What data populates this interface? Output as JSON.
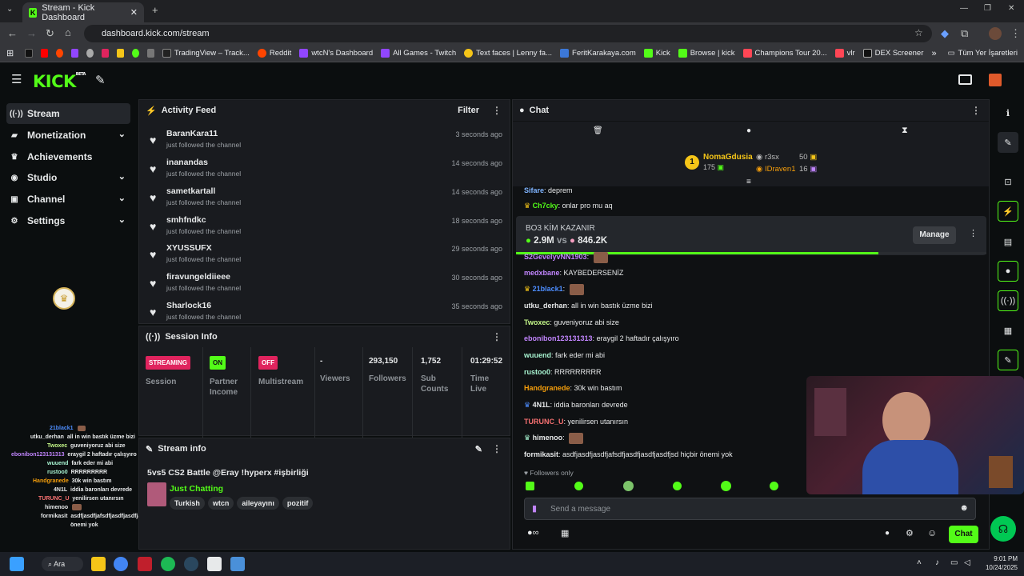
{
  "browser": {
    "tab_title": "Stream - Kick Dashboard",
    "url": "dashboard.kick.com/stream",
    "bookmarks": [
      "TradingView – Track...",
      "Reddit",
      "wtcN's Dashboard",
      "All Games - Twitch",
      "Text faces | Lenny fa...",
      "FeritKarakaya.com",
      "Kick",
      "Browse | kick",
      "Champions Tour 20...",
      "vlr",
      "DEX Screener"
    ],
    "bookmarks_folder": "Tüm Yer İşaretleri"
  },
  "app": {
    "logo": "KICK",
    "beta": "BETA"
  },
  "sidebar": {
    "items": [
      {
        "label": "Stream",
        "icon": "broadcast-icon"
      },
      {
        "label": "Monetization",
        "icon": "dollar-icon"
      },
      {
        "label": "Achievements",
        "icon": "trophy-icon"
      },
      {
        "label": "Studio",
        "icon": "camera-icon"
      },
      {
        "label": "Channel",
        "icon": "tv-icon"
      },
      {
        "label": "Settings",
        "icon": "gear-icon"
      }
    ]
  },
  "activity_feed": {
    "title": "Activity Feed",
    "filter": "Filter",
    "items": [
      {
        "name": "BaranKara11",
        "action": "just followed the channel",
        "time": "3 seconds ago"
      },
      {
        "name": "inanandas",
        "action": "just followed the channel",
        "time": "14 seconds ago"
      },
      {
        "name": "sametkartall",
        "action": "just followed the channel",
        "time": "14 seconds ago"
      },
      {
        "name": "smhfndkc",
        "action": "just followed the channel",
        "time": "18 seconds ago"
      },
      {
        "name": "XYUSSUFX",
        "action": "just followed the channel",
        "time": "29 seconds ago"
      },
      {
        "name": "firavungeldiieee",
        "action": "just followed the channel",
        "time": "30 seconds ago"
      },
      {
        "name": "Sharlock16",
        "action": "just followed the channel",
        "time": "35 seconds ago"
      }
    ]
  },
  "session_info": {
    "title": "Session Info",
    "session_badge": "STREAMING",
    "session_label": "Session",
    "partner_badge": "ON",
    "partner_label_1": "Partner",
    "partner_label_2": "Income",
    "multistream_badge": "OFF",
    "multistream_label": "Multistream",
    "viewers_value": "-",
    "viewers_label": "Viewers",
    "followers_value": "293,150",
    "followers_label": "Followers",
    "subs_value": "1,752",
    "subs_label_1": "Sub",
    "subs_label_2": "Counts",
    "time_value": "01:29:52",
    "time_label_1": "Time",
    "time_label_2": "Live"
  },
  "stream_info": {
    "title": "Stream info",
    "stream_title": "5vs5 CS2 Battle @Eray !hyperx #işbirliği",
    "category": "Just Chatting",
    "tags": [
      "Turkish",
      "wtcn",
      "aileyayını",
      "pozitif"
    ]
  },
  "chat": {
    "title": "Chat",
    "leaderboard": {
      "rank": "1",
      "top_name": "NomaGdusia",
      "top_value": "175",
      "second_name": "r3sx",
      "second_value": "50",
      "third_name": "IDraven1",
      "third_value": "16"
    },
    "poll": {
      "title": "BO3 KİM KAZANIR",
      "left": "2.9M",
      "vs": "vs",
      "right": "846.2K",
      "manage": "Manage",
      "progress": 0.77
    },
    "messages": [
      {
        "user": "Sifare",
        "text": "deprem",
        "color": "#7fb4ff"
      },
      {
        "user": "Ch7cky",
        "text": "onlar pro mu aq",
        "color": "#53fc18"
      },
      {
        "user": "S2GevelyvNN1903",
        "text": "",
        "color": "#c084fc"
      },
      {
        "user": "medxbane",
        "text": "KAYBEDERSENİZ",
        "color": "#c084fc"
      },
      {
        "user": "21black1",
        "text": "",
        "color": "#4d8dff"
      },
      {
        "user": "utku_derhan",
        "text": "all in win bastık üzme bizi",
        "color": "#e7e9ea"
      },
      {
        "user": "Twoxec",
        "text": "guveniyoruz abi size",
        "color": "#c6f98a"
      },
      {
        "user": "ebonibon123131313",
        "text": "eraygil 2 haftadır çalışyıro",
        "color": "#c084fc"
      },
      {
        "user": "wuuend",
        "text": "fark eder mi abi",
        "color": "#a7f3d0"
      },
      {
        "user": "rustoo0",
        "text": "RRRRRRRRR",
        "color": "#a7f3d0"
      },
      {
        "user": "Handgranede",
        "text": "30k win bastım",
        "color": "#f59e0b"
      },
      {
        "user": "4N1L",
        "text": "iddia baronları devrede",
        "color": "#e7e9ea"
      },
      {
        "user": "TURUNC_U",
        "text": "yenilirsen utanırsın",
        "color": "#f87171"
      },
      {
        "user": "himenoo",
        "text": "",
        "color": "#e7e9ea"
      },
      {
        "user": "formikasit",
        "text": "asdfjasdfjasdfjafsdfjasdfjasdfjasdfjsd hiçbir önemi yok",
        "color": "#e7e9ea"
      }
    ],
    "followers_only": "Followers only",
    "input_placeholder": "Send a message",
    "send_label": "Chat"
  },
  "overlay": {
    "lines": [
      {
        "user": "21black1",
        "text": ""
      },
      {
        "user": "utku_derhan",
        "text": "all in win bastık üzme bizi"
      },
      {
        "user": "Twoxec",
        "text": "guveniyoruz abi size"
      },
      {
        "user": "ebonibon123131313",
        "text": "eraygil 2 haftadır çalışyıro"
      },
      {
        "user": "wuuend",
        "text": "fark eder mi abi"
      },
      {
        "user": "rustoo0",
        "text": "RRRRRRRRR"
      },
      {
        "user": "Handgranede",
        "text": "30k win bastım"
      },
      {
        "user": "4N1L",
        "text": "iddia baronları devrede"
      },
      {
        "user": "TURUNC_U",
        "text": "yenilirsen utanırsın"
      },
      {
        "user": "himenoo",
        "text": ""
      },
      {
        "user": "formikasit",
        "text": "asdfjasdfjafsdfjasdfjasdfjasdfjsd hiçbir"
      },
      {
        "user": "",
        "text": "önemi yok"
      }
    ]
  },
  "taskbar": {
    "search": "Ara",
    "time": "9:01 PM",
    "date": "10/24/2025"
  }
}
